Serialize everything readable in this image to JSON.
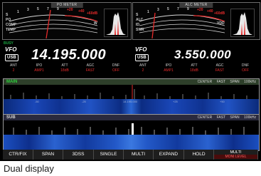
{
  "meters": {
    "left_title": "PO METER",
    "right_title": "ALC METER",
    "left_scale_labels": [
      "S",
      "PO",
      "COMP",
      "TEMP"
    ],
    "left_scale_numbers": [
      "1",
      "3",
      "5",
      "7",
      "9",
      "+20",
      "+40",
      "+60dB"
    ],
    "left_unit": "W",
    "right_scale_labels": [
      "S",
      "ALC",
      "ID",
      "SWR"
    ],
    "right_scale_numbers": [
      "1",
      "3",
      "5",
      "7",
      "9",
      "+20",
      "+40",
      "+60dB"
    ],
    "right_unit": "VDD"
  },
  "busy_label": "BUSY",
  "main_vfo": {
    "vfo": "VFO",
    "mode": "USB",
    "frequency": "14.195.000",
    "status": [
      {
        "label": "ANT",
        "value": "2"
      },
      {
        "label": "IPO",
        "value": "AMP1"
      },
      {
        "label": "ATT",
        "value": "18dB"
      },
      {
        "label": "AGC",
        "value": "FAST"
      },
      {
        "label": "DNF",
        "value": "OFF"
      }
    ]
  },
  "sub_vfo": {
    "vfo": "VFO",
    "mode": "USB",
    "frequency": "3.550.000",
    "status": [
      {
        "label": "ANT",
        "value": "2"
      },
      {
        "label": "IPO",
        "value": "AMP1"
      },
      {
        "label": "ATT",
        "value": "18dB"
      },
      {
        "label": "AGC",
        "value": "FAST"
      },
      {
        "label": "DNF",
        "value": "OFF"
      }
    ]
  },
  "main_scope": {
    "label": "MAIN",
    "mode": "CENTER",
    "speed": "FAST",
    "span_label": "SPAN",
    "span_value": "100kHz",
    "axis": [
      "-50",
      "-25",
      "14.195.000",
      "+25",
      "+50"
    ]
  },
  "sub_scope": {
    "label": "SUB",
    "mode": "CENTER",
    "speed": "FAST",
    "span_label": "SPAN",
    "span_value": "100kHz"
  },
  "function_keys": {
    "ctr_fix": "CTR/FIX",
    "span": "SPAN",
    "three_dss": "3DSS",
    "single": "SINGLE",
    "multi": "MULTI",
    "expand": "EXPAND",
    "hold": "HOLD",
    "multi_mode": "MULTI",
    "multi_mode_sub": "MONI LEVEL"
  },
  "caption": "Dual display",
  "colors": {
    "accent_green": "#2ed13c",
    "status_red": "#e52a2a",
    "waterfall_blue": "#1a47b8"
  }
}
